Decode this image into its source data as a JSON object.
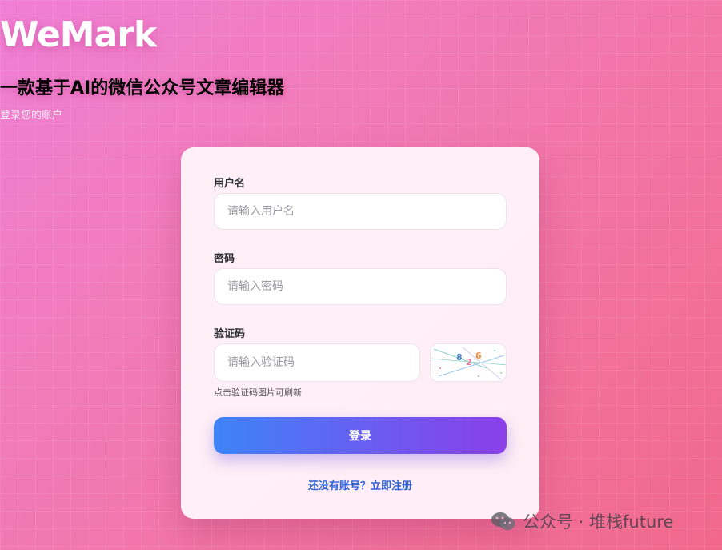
{
  "app": {
    "logo": "WeMark",
    "subtitle": "一款基于AI的微信公众号文章编辑器",
    "tagline": "登录您的账户"
  },
  "form": {
    "username": {
      "label": "用户名",
      "placeholder": "请输入用户名",
      "value": ""
    },
    "password": {
      "label": "密码",
      "placeholder": "请输入密码",
      "value": ""
    },
    "captcha": {
      "label": "验证码",
      "placeholder": "请输入验证码",
      "value": "",
      "image_text": [
        "8",
        "2",
        "6"
      ],
      "hint": "点击验证码图片可刷新"
    },
    "login_label": "登录",
    "register_link": "还没有账号？立即注册"
  },
  "watermark": {
    "icon": "wechat-icon",
    "text": "公众号 · 堆栈future"
  },
  "colors": {
    "bg_start": "#f07fd6",
    "bg_end": "#f1688b",
    "button_start": "#3d84f7",
    "button_end": "#8a3fe8",
    "link": "#2f63d6"
  }
}
